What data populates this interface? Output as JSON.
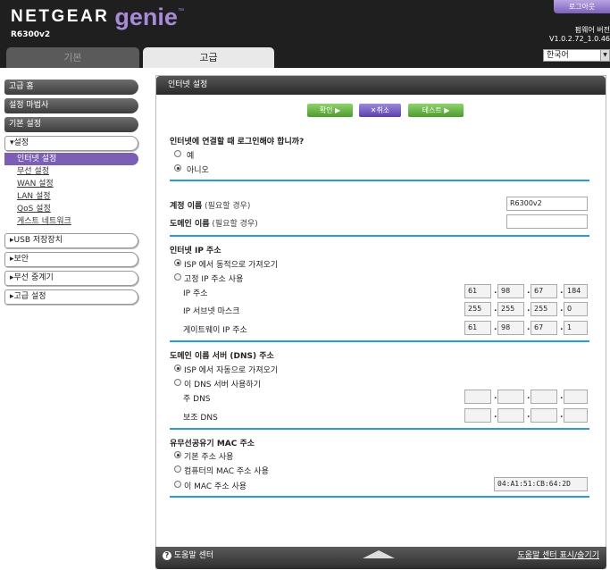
{
  "header": {
    "brand_netgear": "NETGEAR",
    "brand_genie": "genie",
    "brand_tm": "™",
    "model": "R6300v2",
    "logout_label": "로그아웃",
    "firmware_label": "펌웨어 버전",
    "firmware_version": "V1.0.2.72_1.0.46",
    "language": "한국어",
    "tabs": [
      {
        "label": "기본"
      },
      {
        "label": "고급"
      }
    ]
  },
  "sidebar": {
    "items": [
      {
        "label": "고급 홈"
      },
      {
        "label": "설정 마법사"
      },
      {
        "label": "기본 설정"
      }
    ],
    "setup_section": "▾설정",
    "setup_sub": [
      {
        "label": "인터넷 설정"
      },
      {
        "label": "무선 설정"
      },
      {
        "label": "WAN 설정"
      },
      {
        "label": "LAN 설정"
      },
      {
        "label": "QoS 설정"
      },
      {
        "label": "게스트 네트워크"
      }
    ],
    "sections": [
      {
        "label": "▸USB 저장장치"
      },
      {
        "label": "▸보안"
      },
      {
        "label": "▸무선 중계기"
      },
      {
        "label": "▸고급 설정"
      }
    ]
  },
  "panel": {
    "title": "인터넷 설정",
    "buttons": {
      "apply": "확인 ▶",
      "cancel": "✕취소",
      "test": "테스트 ▶"
    },
    "login_question": "인터넷에 연결할 때 로그인해야 합니까?",
    "login_yes": "예",
    "login_no": "아니오",
    "account_label": "계정 이름",
    "account_hint": "(필요할 경우)",
    "account_value": "R6300v2",
    "domain_label": "도메인 이름",
    "domain_hint": "(필요할 경우)",
    "domain_value": "",
    "ip_section": "인터넷 IP 주소",
    "ip_dynamic": "ISP 에서 동적으로 가져오기",
    "ip_static": "고정 IP 주소 사용",
    "ip_addr_label": "IP 주소",
    "ip_addr": [
      "61",
      "98",
      "67",
      "184"
    ],
    "subnet_label": "IP 서브넷 마스크",
    "subnet": [
      "255",
      "255",
      "255",
      "0"
    ],
    "gateway_label": "게이트웨이 IP 주소",
    "gateway": [
      "61",
      "98",
      "67",
      "1"
    ],
    "dns_section": "도메인 이름 서버 (DNS) 주소",
    "dns_auto": "ISP 에서 자동으로 가져오기",
    "dns_manual": "이 DNS 서버 사용하기",
    "dns_primary_label": "주 DNS",
    "dns_secondary_label": "보조 DNS",
    "mac_section": "유무선공유기 MAC 주소",
    "mac_default": "기본 주소 사용",
    "mac_computer": "컴퓨터의 MAC 주소 사용",
    "mac_this": "이 MAC 주소 사용",
    "mac_value": "04:A1:51:CB:64:2D"
  },
  "footer": {
    "help_icon": "?",
    "help_center": "도움말 센터",
    "toggle_help": "도움말 센터 표시/숨기기"
  }
}
